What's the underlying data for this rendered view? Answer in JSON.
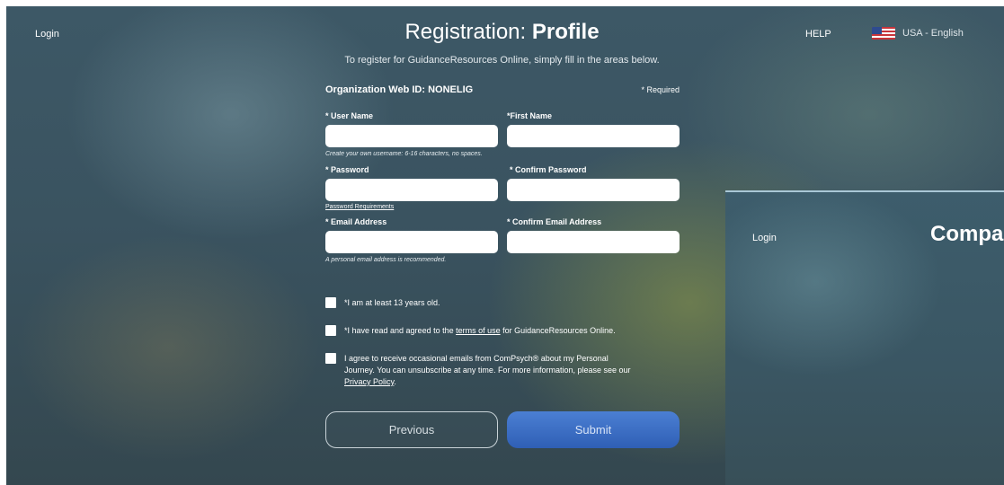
{
  "header": {
    "login": "Login",
    "help": "HELP",
    "language": "USA - English",
    "title_prefix": "Registration: ",
    "title_bold": "Profile",
    "subtitle": "To register for GuidanceResources Online, simply fill in the areas below."
  },
  "form": {
    "org_label": "Organization Web ID:  NONELIG",
    "required_note": "* Required",
    "fields": {
      "username": {
        "label": "* User Name",
        "value": "",
        "hint": "Create your own username: 6-16 characters, no spaces."
      },
      "first_name": {
        "label": "*First Name",
        "value": ""
      },
      "password": {
        "label": "* Password",
        "value": "",
        "link": "Password Requirements"
      },
      "confirm_password": {
        "label": "* Confirm Password",
        "value": ""
      },
      "email": {
        "label": "* Email Address",
        "value": "",
        "hint": "A personal email address is recommended."
      },
      "confirm_email": {
        "label": "* Confirm Email Address",
        "value": ""
      }
    },
    "checks": {
      "age": "*I am at least 13 years old.",
      "terms_before": "*I have read and agreed to the ",
      "terms_link": "terms of use",
      "terms_after": " for GuidanceResources Online.",
      "emails_text": "I agree to receive occasional emails from ComPsych® about my Personal Journey. You can unsubscribe at any time. For more information, please see our ",
      "privacy_link": "Privacy Policy",
      "emails_end": "."
    },
    "buttons": {
      "previous": "Previous",
      "submit": "Submit"
    }
  },
  "overlay": {
    "login": "Login",
    "title": "Compa"
  }
}
